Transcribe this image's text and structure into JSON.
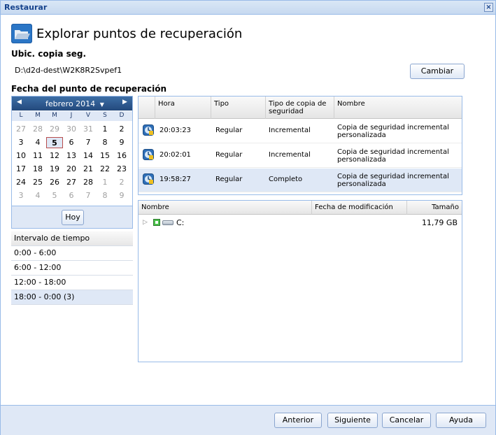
{
  "window": {
    "title": "Restaurar",
    "close_label": "×"
  },
  "heading": {
    "title": "Explorar puntos de recuperación"
  },
  "backup_location": {
    "label": "Ubic. copia seg.",
    "path": "D:\\d2d-dest\\W2K8R2Svpef1",
    "change_button": "Cambiar"
  },
  "recovery_date": {
    "label": "Fecha del punto de recuperación"
  },
  "calendar": {
    "prev_icon": "left-triangle-icon",
    "next_icon": "right-triangle-icon",
    "month": "febrero 2014",
    "dropdown_icon": "▼",
    "day_names": [
      "L",
      "M",
      "M",
      "J",
      "V",
      "S",
      "D"
    ],
    "weeks": [
      [
        "27",
        "28",
        "29",
        "30",
        "31",
        "1",
        "2"
      ],
      [
        "3",
        "4",
        "5",
        "6",
        "7",
        "8",
        "9"
      ],
      [
        "10",
        "11",
        "12",
        "13",
        "14",
        "15",
        "16"
      ],
      [
        "17",
        "18",
        "19",
        "20",
        "21",
        "22",
        "23"
      ],
      [
        "24",
        "25",
        "26",
        "27",
        "28",
        "1",
        "2"
      ],
      [
        "3",
        "4",
        "5",
        "6",
        "7",
        "8",
        "9"
      ]
    ],
    "today_button": "Hoy"
  },
  "interval": {
    "header": "Intervalo de tiempo",
    "items": [
      "0:00 - 6:00",
      "6:00 - 12:00",
      "12:00 - 18:00",
      "18:00 - 0:00 (3)"
    ]
  },
  "recovery_points": {
    "columns": [
      "Hora",
      "Tipo",
      "Tipo de copia de seguridad",
      "Nombre"
    ],
    "rows": [
      {
        "time": "20:03:23",
        "type": "Regular",
        "backup_type": "Incremental",
        "name": "Copia de seguridad incremental personalizada"
      },
      {
        "time": "20:02:01",
        "type": "Regular",
        "backup_type": "Incremental",
        "name": "Copia de seguridad incremental personalizada"
      },
      {
        "time": "19:58:27",
        "type": "Regular",
        "backup_type": "Completo",
        "name": "Copia de seguridad incremental personalizada"
      }
    ]
  },
  "files": {
    "columns": [
      "Nombre",
      "Fecha de modificación",
      "Tamaño"
    ],
    "rows": [
      {
        "name": "C:",
        "modified": "",
        "size": "11,79 GB"
      }
    ]
  },
  "footer": {
    "prev": "Anterior",
    "next": "Siguiente",
    "cancel": "Cancelar",
    "help": "Ayuda"
  },
  "colors": {
    "accent": "#15428b",
    "border": "#99bbe8",
    "selection": "#dfe8f6",
    "calendar_header": "#23497c"
  }
}
